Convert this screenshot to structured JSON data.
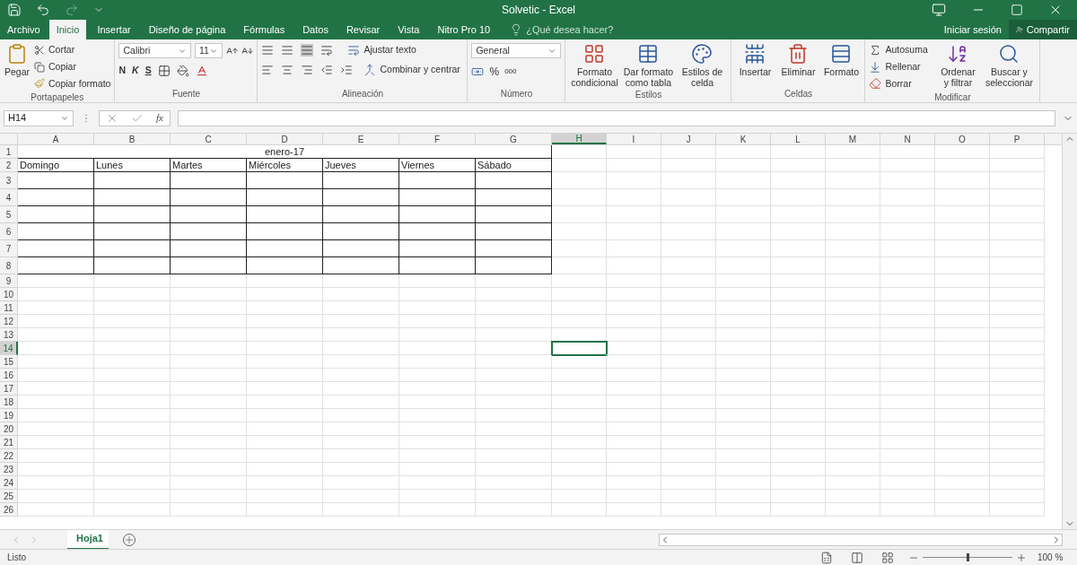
{
  "window": {
    "title": "Solvetic - Excel"
  },
  "tabs": [
    {
      "label": "Archivo",
      "selected": false
    },
    {
      "label": "Inicio",
      "selected": true
    },
    {
      "label": "Insertar",
      "selected": false
    },
    {
      "label": "Diseño de página",
      "selected": false
    },
    {
      "label": "Fórmulas",
      "selected": false
    },
    {
      "label": "Datos",
      "selected": false
    },
    {
      "label": "Revisar",
      "selected": false
    },
    {
      "label": "Vista",
      "selected": false
    },
    {
      "label": "Nitro Pro 10",
      "selected": false
    }
  ],
  "tell_me": {
    "placeholder": "¿Qué desea hacer?"
  },
  "account": {
    "sign_in": "Iniciar sesión",
    "share": "Compartir"
  },
  "ribbon": {
    "clipboard": {
      "title": "Portapapeles",
      "paste": "Pegar",
      "cut": "Cortar",
      "copy": "Copiar",
      "format_painter": "Copiar formato"
    },
    "font": {
      "title": "Fuente",
      "family": "Calibri",
      "size": "11",
      "bold": "N",
      "italic": "K",
      "underline": "S"
    },
    "alignment": {
      "title": "Alineación",
      "wrap": "Ajustar texto",
      "merge": "Combinar y centrar"
    },
    "number": {
      "title": "Número",
      "format": "General",
      "percent": "%",
      "thousands": "000"
    },
    "styles": {
      "title": "Estilos",
      "buttons": [
        "Formato condicional",
        "Dar formato como tabla",
        "Estilos de celda"
      ]
    },
    "cells": {
      "title": "Celdas",
      "buttons": [
        "Insertar",
        "Eliminar",
        "Formato"
      ]
    },
    "editing": {
      "title": "Modificar",
      "autosum": "Autosuma",
      "fill": "Rellenar",
      "clear": "Borrar",
      "sort": "Ordenar y filtrar",
      "find": "Buscar y seleccionar"
    }
  },
  "formula_bar": {
    "name_box": "H14",
    "fx": "fx"
  },
  "sheet": {
    "columns": [
      {
        "label": "A",
        "selected": false
      },
      {
        "label": "B",
        "selected": false
      },
      {
        "label": "C",
        "selected": false
      },
      {
        "label": "D",
        "selected": false
      },
      {
        "label": "E",
        "selected": false
      },
      {
        "label": "F",
        "selected": false
      },
      {
        "label": "G",
        "selected": false
      },
      {
        "label": "H",
        "selected": true
      },
      {
        "label": "I",
        "selected": false
      },
      {
        "label": "J",
        "selected": false
      },
      {
        "label": "K",
        "selected": false
      },
      {
        "label": "L",
        "selected": false
      },
      {
        "label": "M",
        "selected": false
      },
      {
        "label": "N",
        "selected": false
      },
      {
        "label": "O",
        "selected": false
      },
      {
        "label": "P",
        "selected": false
      }
    ],
    "rows": [
      {
        "label": "1",
        "selected": false,
        "kind": "merged",
        "text": "enero-17"
      },
      {
        "label": "2",
        "selected": false,
        "kind": "cells",
        "cells": [
          "Domingo",
          "Lunes",
          "Martes",
          "Miércoles",
          "Jueves",
          "Viernes",
          "Sábado"
        ]
      },
      {
        "label": "3",
        "selected": false,
        "kind": "boxed"
      },
      {
        "label": "4",
        "selected": false,
        "kind": "boxed"
      },
      {
        "label": "5",
        "selected": false,
        "kind": "boxed"
      },
      {
        "label": "6",
        "selected": false,
        "kind": "boxed"
      },
      {
        "label": "7",
        "selected": false,
        "kind": "boxed"
      },
      {
        "label": "8",
        "selected": false,
        "kind": "boxed"
      },
      {
        "label": "9",
        "selected": false,
        "kind": "plain"
      },
      {
        "label": "10",
        "selected": false,
        "kind": "plain"
      },
      {
        "label": "11",
        "selected": false,
        "kind": "plain"
      },
      {
        "label": "12",
        "selected": false,
        "kind": "plain"
      },
      {
        "label": "13",
        "selected": false,
        "kind": "plain"
      },
      {
        "label": "14",
        "selected": true,
        "kind": "plain"
      },
      {
        "label": "15",
        "selected": false,
        "kind": "plain"
      },
      {
        "label": "16",
        "selected": false,
        "kind": "plain"
      },
      {
        "label": "17",
        "selected": false,
        "kind": "plain"
      },
      {
        "label": "18",
        "selected": false,
        "kind": "plain"
      },
      {
        "label": "19",
        "selected": false,
        "kind": "plain"
      },
      {
        "label": "20",
        "selected": false,
        "kind": "plain"
      },
      {
        "label": "21",
        "selected": false,
        "kind": "plain"
      },
      {
        "label": "22",
        "selected": false,
        "kind": "plain"
      },
      {
        "label": "23",
        "selected": false,
        "kind": "plain"
      },
      {
        "label": "24",
        "selected": false,
        "kind": "plain"
      },
      {
        "label": "25",
        "selected": false,
        "kind": "plain"
      },
      {
        "label": "26",
        "selected": false,
        "kind": "plain"
      }
    ]
  },
  "sheet_tabs": [
    {
      "label": "Hoja1",
      "selected": true
    }
  ],
  "status_bar": {
    "status": "Listo",
    "zoom": "100 %",
    "zoom_slider": {
      "level": 0.5
    }
  }
}
